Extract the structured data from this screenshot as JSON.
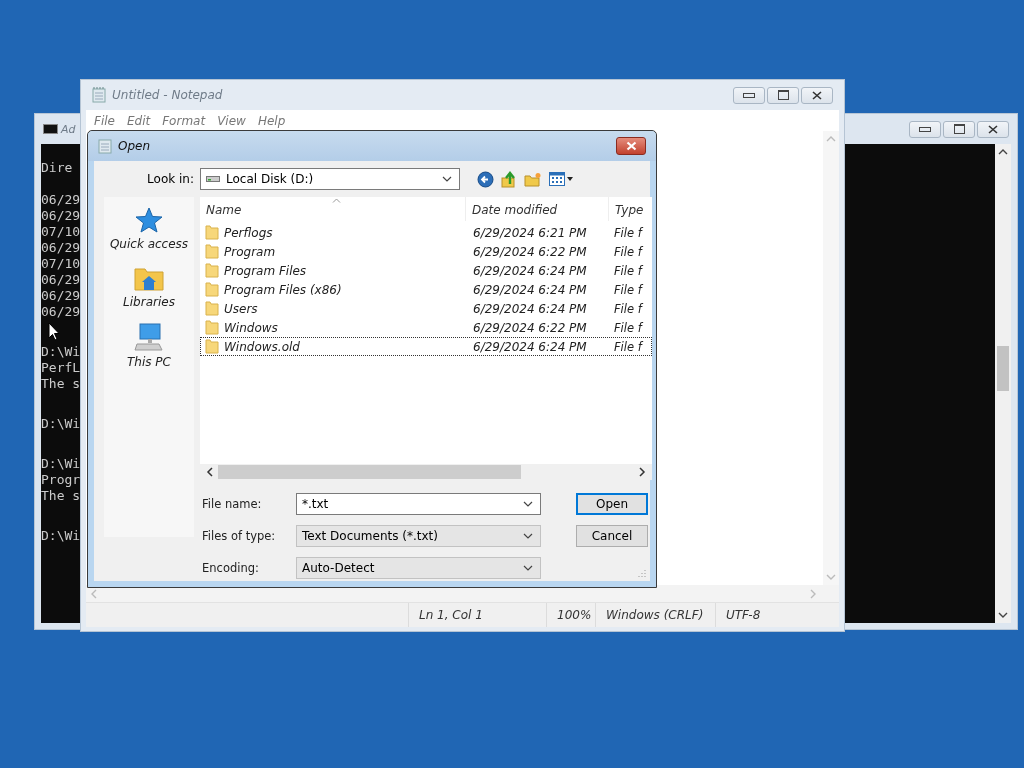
{
  "console_window": {
    "title": "Ad",
    "active": false,
    "blocks": [
      [
        "Dire"
      ],
      [
        "06/29",
        "06/29",
        "07/10",
        "06/29",
        "07/10",
        "06/29",
        "06/29",
        "06/29"
      ],
      [
        "D:\\Wi",
        "PerfL",
        "The s"
      ],
      [
        "D:\\Wi"
      ],
      [
        "D:\\Wi",
        "Progr",
        "The s"
      ],
      [
        "D:\\Wi"
      ]
    ]
  },
  "notepad": {
    "title": "Untitled - Notepad",
    "active": false,
    "menu": [
      "File",
      "Edit",
      "Format",
      "View",
      "Help"
    ],
    "status_bar": {
      "position": "Ln 1, Col 1",
      "zoom": "100%",
      "line_ending": "Windows (CRLF)",
      "encoding": "UTF-8"
    }
  },
  "open_dialog": {
    "title": "Open",
    "active": true,
    "look_in": {
      "label": "Look in:",
      "value": "Local Disk (D:)"
    },
    "places": [
      {
        "label": "Quick access",
        "kind": "star"
      },
      {
        "label": "Libraries",
        "kind": "libraries"
      },
      {
        "label": "This PC",
        "kind": "computer"
      }
    ],
    "columns": [
      "Name",
      "Date modified",
      "Type"
    ],
    "files": [
      {
        "name": "Perflogs",
        "date": "6/29/2024 6:21 PM",
        "type": "File f",
        "focused": false
      },
      {
        "name": "Program",
        "date": "6/29/2024 6:22 PM",
        "type": "File f",
        "focused": false
      },
      {
        "name": "Program Files",
        "date": "6/29/2024 6:24 PM",
        "type": "File f",
        "focused": false
      },
      {
        "name": "Program Files (x86)",
        "date": "6/29/2024 6:24 PM",
        "type": "File f",
        "focused": false
      },
      {
        "name": "Users",
        "date": "6/29/2024 6:24 PM",
        "type": "File f",
        "focused": false
      },
      {
        "name": "Windows",
        "date": "6/29/2024 6:22 PM",
        "type": "File f",
        "focused": false
      },
      {
        "name": "Windows.old",
        "date": "6/29/2024 6:24 PM",
        "type": "File f",
        "focused": true
      }
    ],
    "fields": [
      {
        "label": "File name:",
        "value": "*.txt",
        "kind": "editable"
      },
      {
        "label": "Files of type:",
        "value": "Text Documents (*.txt)",
        "kind": "dropdown"
      },
      {
        "label": "Encoding:",
        "value": "Auto-Detect",
        "kind": "dropdown"
      }
    ],
    "buttons": [
      {
        "label": "Open",
        "default": true
      },
      {
        "label": "Cancel",
        "default": false
      }
    ]
  }
}
